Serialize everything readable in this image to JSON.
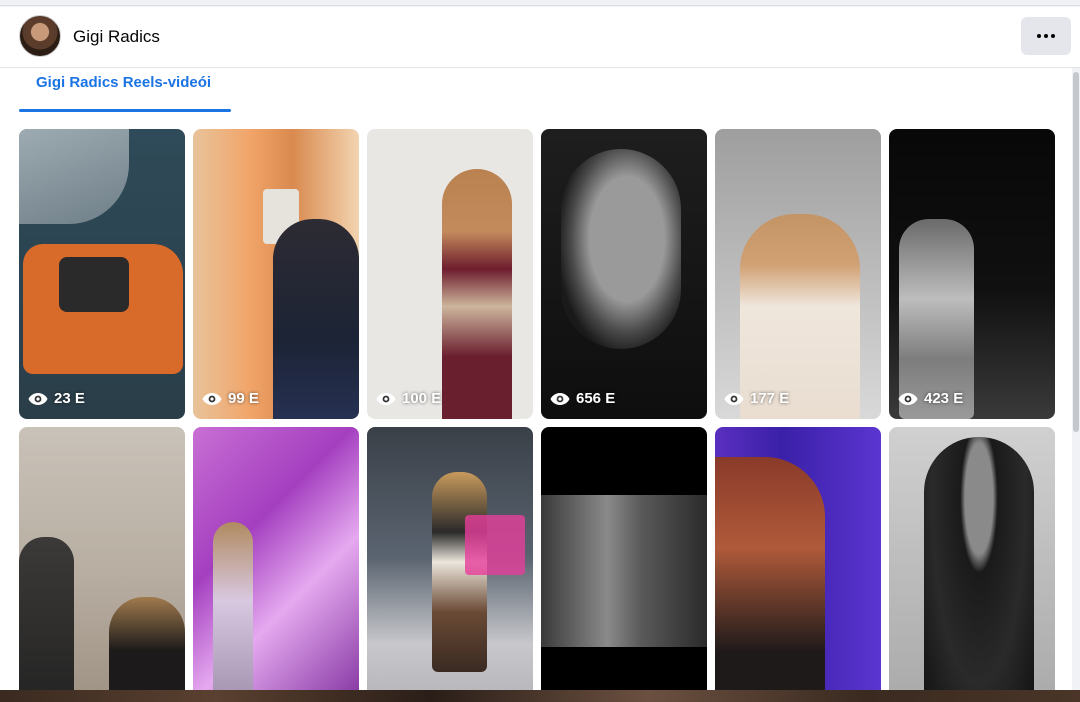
{
  "profile": {
    "name": "Gigi Radics"
  },
  "header": {
    "more_icon": "more-horizontal-icon"
  },
  "tabs": [
    {
      "label": "Gigi Radics Reels-videói",
      "active": true
    }
  ],
  "reels": [
    {
      "views": "23 E"
    },
    {
      "views": "99 E"
    },
    {
      "views": "100 E"
    },
    {
      "views": "656 E"
    },
    {
      "views": "177 E"
    },
    {
      "views": "423 E"
    },
    {
      "views": ""
    },
    {
      "views": ""
    },
    {
      "views": ""
    },
    {
      "views": ""
    },
    {
      "views": ""
    },
    {
      "views": ""
    }
  ],
  "colors": {
    "accent": "#1b74e4",
    "page_bg": "#f0f2f5",
    "card_bg": "#ffffff"
  }
}
